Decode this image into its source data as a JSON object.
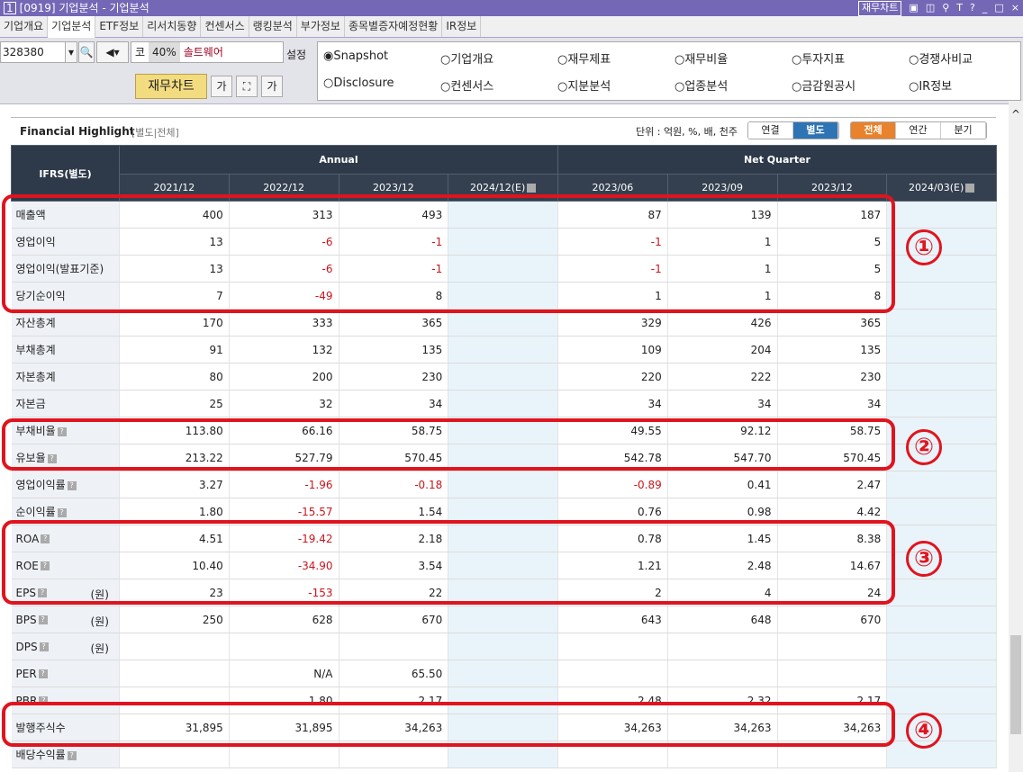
{
  "window": {
    "num": "1",
    "title": "[0919] 기업분석 - 기업분석",
    "chart_btn": "재무차트"
  },
  "tabs": [
    "기업개요",
    "기업분석",
    "ETF정보",
    "리서치동향",
    "컨센서스",
    "랭킹분석",
    "부가정보",
    "종목별증자예정현황",
    "IR정보"
  ],
  "toolbar": {
    "code": "328380",
    "market": "코",
    "pct": "40%",
    "name": "솔트웨어",
    "setting": "설정",
    "fin_chart": "재무차트"
  },
  "radios": [
    {
      "label": "Snapshot",
      "checked": true
    },
    {
      "label": "기업개요"
    },
    {
      "label": "재무제표"
    },
    {
      "label": "재무비율"
    },
    {
      "label": "투자지표"
    },
    {
      "label": "경쟁사비교"
    },
    {
      "label": "Disclosure"
    },
    {
      "label": "컨센서스"
    },
    {
      "label": "지분분석"
    },
    {
      "label": "업종분석"
    },
    {
      "label": "금감원공시"
    },
    {
      "label": "IR정보"
    }
  ],
  "panel": {
    "title": "Financial Highlight",
    "subtitle": "[별도|전체]",
    "unit": "단위 : 억원, %, 배, 천주",
    "seg1": [
      "연결",
      "별도"
    ],
    "seg2": [
      "전체",
      "연간",
      "분기"
    ]
  },
  "table": {
    "corner": "IFRS(별도)",
    "annual": "Annual",
    "quarter": "Net Quarter",
    "cols": [
      "2021/12",
      "2022/12",
      "2023/12",
      "2024/12(E)",
      "2023/06",
      "2023/09",
      "2023/12",
      "2024/03(E)"
    ],
    "rows": [
      {
        "label": "매출액",
        "v": [
          "400",
          "313",
          "493",
          "",
          "87",
          "139",
          "187",
          ""
        ]
      },
      {
        "label": "영업이익",
        "v": [
          "13",
          "-6",
          "-1",
          "",
          "-1",
          "1",
          "5",
          ""
        ]
      },
      {
        "label": "영업이익(발표기준)",
        "v": [
          "13",
          "-6",
          "-1",
          "",
          "-1",
          "1",
          "5",
          ""
        ]
      },
      {
        "label": "당기순이익",
        "v": [
          "7",
          "-49",
          "8",
          "",
          "1",
          "1",
          "8",
          ""
        ]
      },
      {
        "label": "자산총계",
        "v": [
          "170",
          "333",
          "365",
          "",
          "329",
          "426",
          "365",
          ""
        ]
      },
      {
        "label": "부채총계",
        "v": [
          "91",
          "132",
          "135",
          "",
          "109",
          "204",
          "135",
          ""
        ]
      },
      {
        "label": "자본총계",
        "v": [
          "80",
          "200",
          "230",
          "",
          "220",
          "222",
          "230",
          ""
        ]
      },
      {
        "label": "자본금",
        "v": [
          "25",
          "32",
          "34",
          "",
          "34",
          "34",
          "34",
          ""
        ]
      },
      {
        "label": "부채비율",
        "q": true,
        "v": [
          "113.80",
          "66.16",
          "58.75",
          "",
          "49.55",
          "92.12",
          "58.75",
          ""
        ]
      },
      {
        "label": "유보율",
        "q": true,
        "v": [
          "213.22",
          "527.79",
          "570.45",
          "",
          "542.78",
          "547.70",
          "570.45",
          ""
        ]
      },
      {
        "label": "영업이익률",
        "q": true,
        "v": [
          "3.27",
          "-1.96",
          "-0.18",
          "",
          "-0.89",
          "0.41",
          "2.47",
          ""
        ]
      },
      {
        "label": "순이익률",
        "q": true,
        "v": [
          "1.80",
          "-15.57",
          "1.54",
          "",
          "0.76",
          "0.98",
          "4.42",
          ""
        ]
      },
      {
        "label": "ROA",
        "q": true,
        "v": [
          "4.51",
          "-19.42",
          "2.18",
          "",
          "0.78",
          "1.45",
          "8.38",
          ""
        ]
      },
      {
        "label": "ROE",
        "q": true,
        "v": [
          "10.40",
          "-34.90",
          "3.54",
          "",
          "1.21",
          "2.48",
          "14.67",
          ""
        ]
      },
      {
        "label": "EPS",
        "q": true,
        "unit": "(원)",
        "v": [
          "23",
          "-153",
          "22",
          "",
          "2",
          "4",
          "24",
          ""
        ]
      },
      {
        "label": "BPS",
        "q": true,
        "unit": "(원)",
        "v": [
          "250",
          "628",
          "670",
          "",
          "643",
          "648",
          "670",
          ""
        ]
      },
      {
        "label": "DPS",
        "q": true,
        "unit": "(원)",
        "v": [
          "",
          "",
          "",
          "",
          "",
          "",
          "",
          ""
        ]
      },
      {
        "label": "PER",
        "q": true,
        "v": [
          "",
          "N/A",
          "65.50",
          "",
          "",
          "",
          "",
          ""
        ]
      },
      {
        "label": "PBR",
        "q": true,
        "v": [
          "",
          "1.80",
          "2.17",
          "",
          "2.48",
          "2.32",
          "2.17",
          ""
        ]
      },
      {
        "label": "발행주식수",
        "v": [
          "31,895",
          "31,895",
          "34,263",
          "",
          "34,263",
          "34,263",
          "34,263",
          ""
        ]
      },
      {
        "label": "배당수익률",
        "q": true,
        "v": [
          "",
          "",
          "",
          "",
          "",
          "",
          "",
          ""
        ]
      }
    ]
  },
  "annotations": [
    "①",
    "②",
    "③",
    "④"
  ],
  "colors": {
    "titlebar": "#7468b6",
    "header": "#2e3a4a",
    "negative": "#c8161d",
    "annotation": "#e0141e"
  }
}
